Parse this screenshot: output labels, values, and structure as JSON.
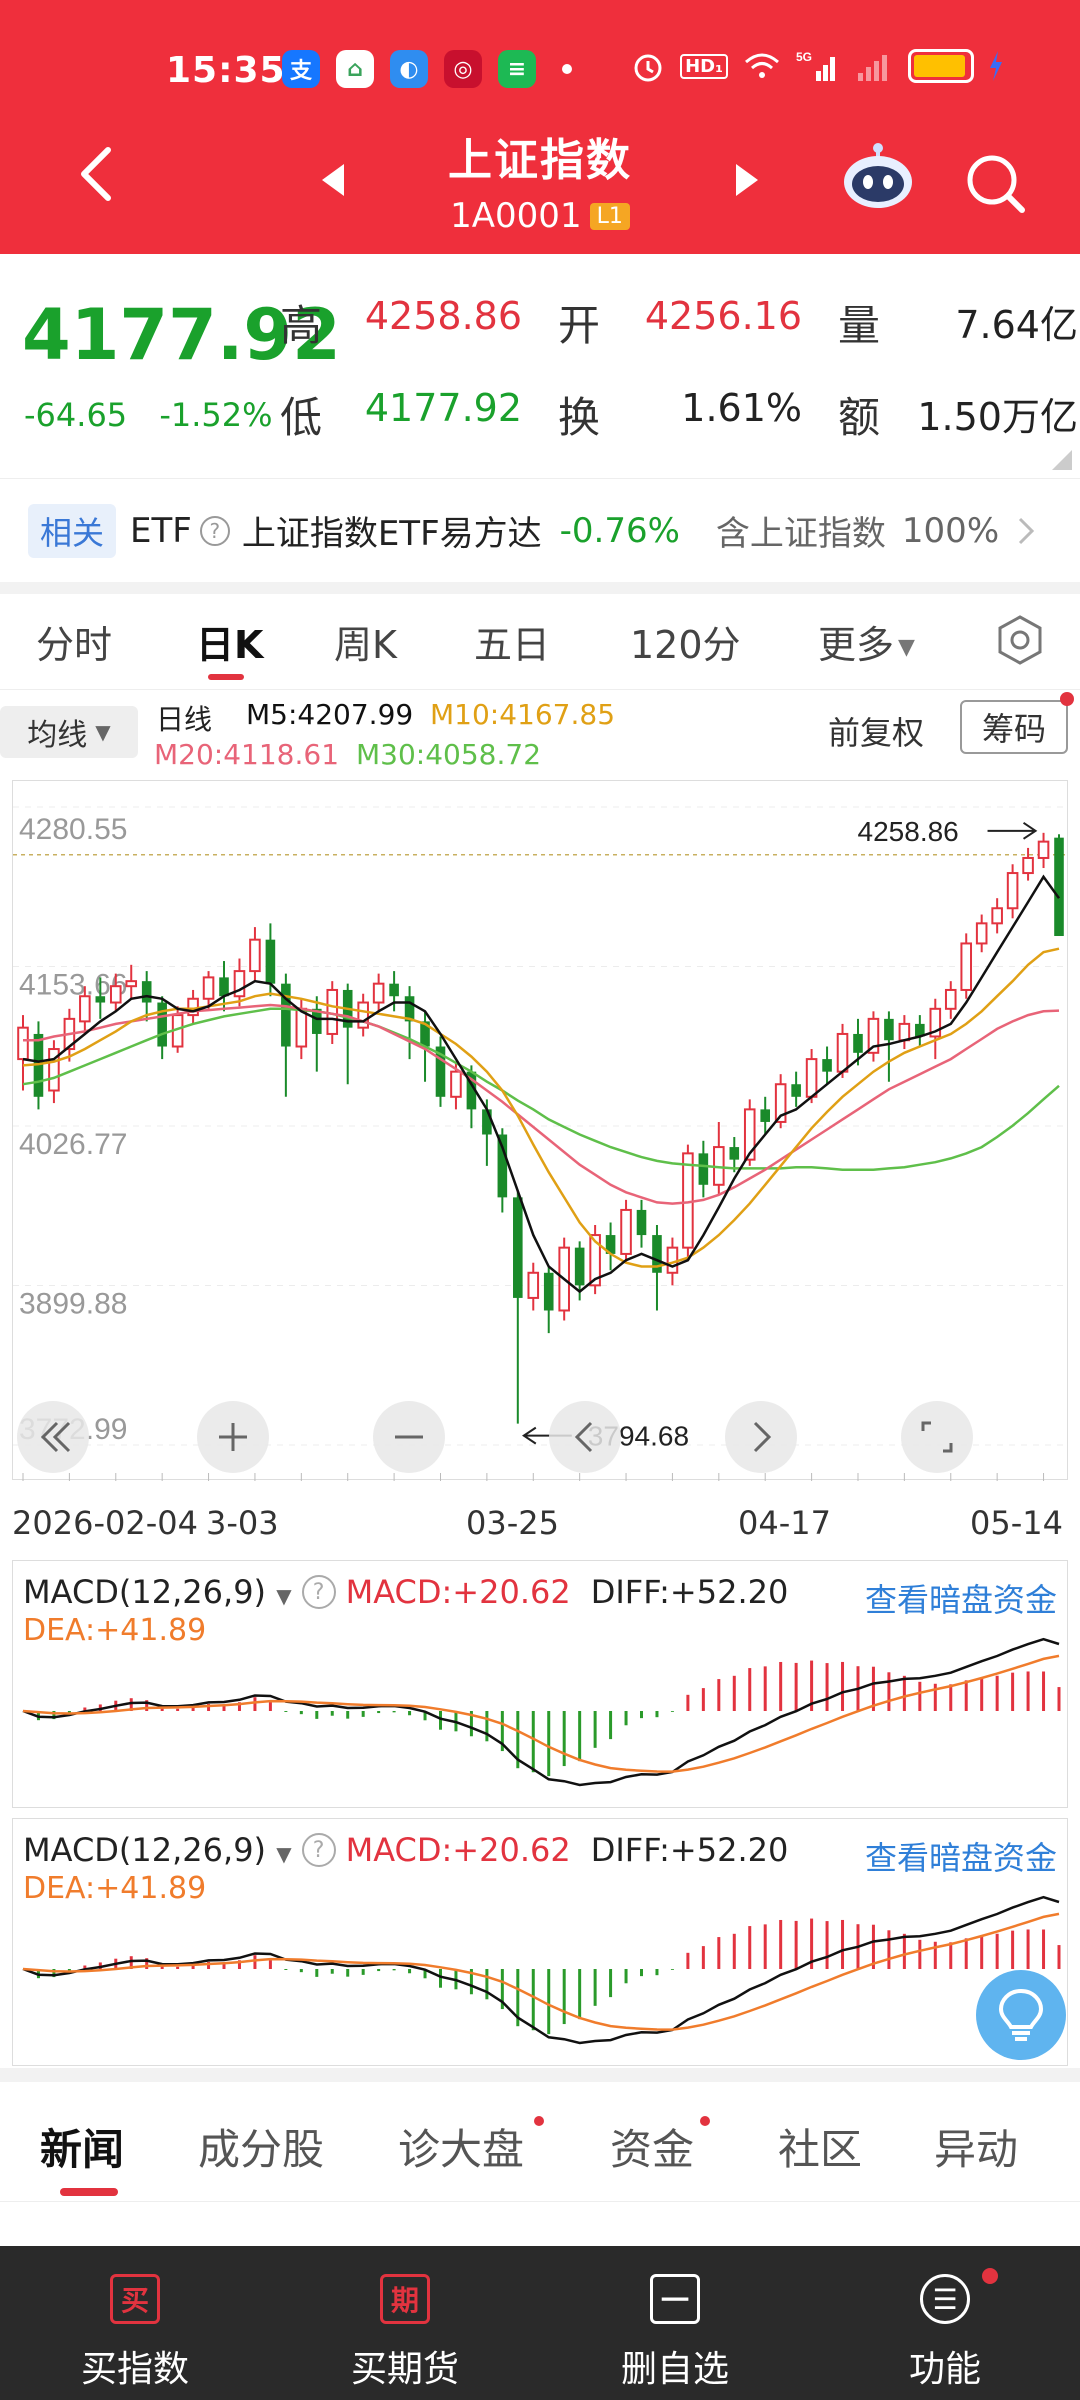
{
  "status_bar": {
    "time": "15:35",
    "app_icons": [
      "alipay-icon",
      "home-app-icon",
      "browser-app-icon",
      "bank-app-icon",
      "message-app-icon"
    ],
    "right_icons": [
      "alarm-icon",
      "hd-icon",
      "wifi-icon",
      "signal-5g-icon",
      "signal-icon",
      "battery-icon",
      "charging-icon"
    ],
    "hd_label": "HD₁",
    "battery_level": 0.95
  },
  "header": {
    "title": "上证指数",
    "code": "1A0001",
    "level_badge": "L1",
    "bg_color": "#ef2f3c"
  },
  "quote": {
    "price": "4177.92",
    "change": "-64.65",
    "change_pct": "-1.52%",
    "high_label": "高",
    "high": "4258.86",
    "open_label": "开",
    "open": "4256.16",
    "volume_label": "量",
    "volume": "7.64亿",
    "low_label": "低",
    "low": "4177.92",
    "turnover_label": "换",
    "turnover": "1.61%",
    "amount_label": "额",
    "amount": "1.50万亿"
  },
  "etf": {
    "tag": "相关",
    "type": "ETF",
    "name": "上证指数ETF易方达",
    "change": "-0.76%",
    "contain_text": "含上证指数",
    "contain_pct": "100%"
  },
  "period_tabs": [
    "分时",
    "日K",
    "周K",
    "五日",
    "120分",
    "更多"
  ],
  "active_period": 1,
  "ma": {
    "select_label": "均线",
    "type_label": "日线",
    "m5": "M5:4207.99",
    "m10": "M10:4167.85",
    "m20": "M20:4118.61",
    "m30": "M30:4058.72",
    "adjust_label": "前复权",
    "chip_label": "筹码",
    "colors": {
      "m5": "#111111",
      "m10": "#e0a015",
      "m20": "#e86478",
      "m30": "#5fbf4a",
      "up": "#e2333f",
      "down": "#1a8a2a"
    }
  },
  "chart_data": {
    "type": "candlestick",
    "y_ticks": [
      "4280.55",
      "4153.66",
      "4026.77",
      "3899.88",
      "3772.99"
    ],
    "ylim": [
      3772.99,
      4280.55
    ],
    "x_labels": [
      "2026-02-04",
      "3-03",
      "03-25",
      "04-17",
      "05-14"
    ],
    "max_marker": "4258.86",
    "min_marker": "3794.68",
    "reference_price": 4242.57,
    "candles": [
      [
        4080,
        4105,
        4055,
        4115
      ],
      [
        4100,
        4050,
        4040,
        4110
      ],
      [
        4055,
        4088,
        4045,
        4095
      ],
      [
        4088,
        4112,
        4078,
        4120
      ],
      [
        4110,
        4130,
        4100,
        4138
      ],
      [
        4130,
        4125,
        4112,
        4145
      ],
      [
        4125,
        4138,
        4118,
        4148
      ],
      [
        4138,
        4142,
        4128,
        4155
      ],
      [
        4142,
        4125,
        4110,
        4150
      ],
      [
        4125,
        4090,
        4080,
        4130
      ],
      [
        4090,
        4115,
        4085,
        4122
      ],
      [
        4115,
        4128,
        4108,
        4135
      ],
      [
        4128,
        4145,
        4120,
        4150
      ],
      [
        4145,
        4130,
        4118,
        4158
      ],
      [
        4130,
        4150,
        4122,
        4160
      ],
      [
        4150,
        4175,
        4142,
        4185
      ],
      [
        4175,
        4140,
        4130,
        4188
      ],
      [
        4140,
        4090,
        4050,
        4148
      ],
      [
        4090,
        4120,
        4080,
        4128
      ],
      [
        4120,
        4100,
        4070,
        4130
      ],
      [
        4100,
        4135,
        4092,
        4142
      ],
      [
        4135,
        4105,
        4060,
        4140
      ],
      [
        4105,
        4125,
        4098,
        4132
      ],
      [
        4125,
        4140,
        4118,
        4148
      ],
      [
        4140,
        4130,
        4118,
        4150
      ],
      [
        4130,
        4110,
        4080,
        4138
      ],
      [
        4110,
        4090,
        4062,
        4118
      ],
      [
        4090,
        4050,
        4042,
        4098
      ],
      [
        4050,
        4070,
        4040,
        4078
      ],
      [
        4070,
        4040,
        4025,
        4075
      ],
      [
        4040,
        4020,
        3995,
        4048
      ],
      [
        4020,
        3970,
        3958,
        4025
      ],
      [
        3970,
        3890,
        3790,
        3975
      ],
      [
        3890,
        3910,
        3880,
        3918
      ],
      [
        3910,
        3880,
        3862,
        3915
      ],
      [
        3880,
        3930,
        3872,
        3938
      ],
      [
        3930,
        3900,
        3888,
        3935
      ],
      [
        3900,
        3940,
        3893,
        3948
      ],
      [
        3940,
        3925,
        3912,
        3950
      ],
      [
        3925,
        3960,
        3918,
        3968
      ],
      [
        3960,
        3940,
        3930,
        3968
      ],
      [
        3940,
        3910,
        3880,
        3948
      ],
      [
        3910,
        3930,
        3900,
        3938
      ],
      [
        3930,
        4005,
        3922,
        4012
      ],
      [
        4005,
        3980,
        3970,
        4015
      ],
      [
        3980,
        4010,
        3972,
        4030
      ],
      [
        4010,
        4000,
        3990,
        4018
      ],
      [
        4000,
        4040,
        3995,
        4048
      ],
      [
        4040,
        4030,
        4020,
        4050
      ],
      [
        4030,
        4060,
        4025,
        4068
      ],
      [
        4060,
        4050,
        4042,
        4070
      ],
      [
        4050,
        4080,
        4045,
        4088
      ],
      [
        4080,
        4070,
        4060,
        4090
      ],
      [
        4070,
        4100,
        4065,
        4108
      ],
      [
        4100,
        4085,
        4075,
        4112
      ],
      [
        4085,
        4112,
        4078,
        4118
      ],
      [
        4112,
        4095,
        4062,
        4118
      ],
      [
        4095,
        4108,
        4088,
        4115
      ],
      [
        4108,
        4098,
        4090,
        4115
      ],
      [
        4098,
        4120,
        4080,
        4128
      ],
      [
        4120,
        4135,
        4112,
        4142
      ],
      [
        4135,
        4172,
        4128,
        4180
      ],
      [
        4172,
        4188,
        4165,
        4195
      ],
      [
        4188,
        4200,
        4180,
        4208
      ],
      [
        4200,
        4228,
        4192,
        4235
      ],
      [
        4228,
        4240,
        4222,
        4248
      ],
      [
        4240,
        4253,
        4232,
        4260
      ],
      [
        4256.16,
        4177.92,
        4177.92,
        4258.86
      ]
    ],
    "ma_series": {
      "m5": [
        4080,
        4078,
        4080,
        4090,
        4100,
        4110,
        4118,
        4128,
        4130,
        4128,
        4120,
        4118,
        4122,
        4130,
        4135,
        4142,
        4140,
        4128,
        4118,
        4112,
        4112,
        4110,
        4110,
        4118,
        4125,
        4125,
        4118,
        4100,
        4080,
        4060,
        4040,
        4010,
        3975,
        3940,
        3915,
        3905,
        3895,
        3905,
        3910,
        3920,
        3925,
        3920,
        3915,
        3920,
        3940,
        3962,
        3985,
        4005,
        4020,
        4035,
        4040,
        4050,
        4060,
        4070,
        4080,
        4090,
        4092,
        4095,
        4098,
        4102,
        4108,
        4125,
        4145,
        4165,
        4185,
        4205,
        4225,
        4207.99
      ],
      "m10": [
        4075,
        4076,
        4078,
        4082,
        4088,
        4095,
        4102,
        4110,
        4115,
        4118,
        4120,
        4120,
        4122,
        4124,
        4126,
        4130,
        4132,
        4130,
        4128,
        4125,
        4122,
        4120,
        4118,
        4116,
        4114,
        4112,
        4108,
        4100,
        4092,
        4082,
        4070,
        4055,
        4035,
        4012,
        3990,
        3970,
        3950,
        3935,
        3925,
        3918,
        3915,
        3915,
        3918,
        3922,
        3930,
        3940,
        3952,
        3965,
        3980,
        3995,
        4010,
        4025,
        4038,
        4050,
        4060,
        4070,
        4078,
        4085,
        4090,
        4095,
        4100,
        4108,
        4118,
        4130,
        4142,
        4155,
        4165,
        4167.85
      ],
      "m20": [
        4095,
        4095,
        4098,
        4100,
        4102,
        4105,
        4108,
        4110,
        4112,
        4114,
        4116,
        4118,
        4119,
        4120,
        4121,
        4122,
        4123,
        4122,
        4120,
        4118,
        4116,
        4114,
        4110,
        4106,
        4100,
        4094,
        4088,
        4080,
        4072,
        4064,
        4055,
        4046,
        4036,
        4026,
        4016,
        4006,
        3996,
        3988,
        3980,
        3974,
        3970,
        3966,
        3965,
        3966,
        3968,
        3972,
        3978,
        3985,
        3992,
        4000,
        4008,
        4016,
        4024,
        4032,
        4040,
        4048,
        4056,
        4062,
        4068,
        4074,
        4080,
        4088,
        4096,
        4104,
        4110,
        4115,
        4118,
        4118.61
      ],
      "m30": [
        4060,
        4062,
        4065,
        4070,
        4075,
        4080,
        4085,
        4090,
        4095,
        4100,
        4104,
        4108,
        4111,
        4114,
        4116,
        4118,
        4120,
        4120,
        4119,
        4118,
        4116,
        4113,
        4110,
        4106,
        4101,
        4096,
        4090,
        4084,
        4077,
        4070,
        4062,
        4055,
        4047,
        4040,
        4032,
        4026,
        4020,
        4015,
        4010,
        4006,
        4002,
        3999,
        3997,
        3996,
        3995,
        3994,
        3993,
        3993,
        3993,
        3993,
        3994,
        3994,
        3993,
        3992,
        3992,
        3992,
        3993,
        3994,
        3996,
        3998,
        4001,
        4005,
        4010,
        4018,
        4027,
        4037,
        4048,
        4058.72
      ]
    }
  },
  "chart_controls": [
    "rewind-icon",
    "zoom-in-icon",
    "zoom-out-icon",
    "prev-icon",
    "next-icon",
    "fullscreen-icon"
  ],
  "macd": [
    {
      "select_label": "MACD(12,26,9)",
      "macd": "MACD:+20.62",
      "diff": "DIFF:+52.20",
      "dea": "DEA:+41.89",
      "link": "查看暗盘资金"
    },
    {
      "select_label": "MACD(12,26,9)",
      "macd": "MACD:+20.62",
      "diff": "DIFF:+52.20",
      "dea": "DEA:+41.89",
      "link": "查看暗盘资金"
    }
  ],
  "news_tabs": [
    "新闻",
    "成分股",
    "诊大盘",
    "资金",
    "社区",
    "异动"
  ],
  "active_news_tab": 0,
  "news_tab_dots": [
    2,
    3
  ],
  "bottom_bar": [
    {
      "icon": "买",
      "label": "买指数",
      "icon_name": "buy-icon"
    },
    {
      "icon": "期",
      "label": "买期货",
      "icon_name": "futures-icon"
    },
    {
      "icon": "一",
      "label": "删自选",
      "icon_name": "remove-watchlist-icon"
    },
    {
      "icon": "☰",
      "label": "功能",
      "icon_name": "function-icon"
    }
  ]
}
